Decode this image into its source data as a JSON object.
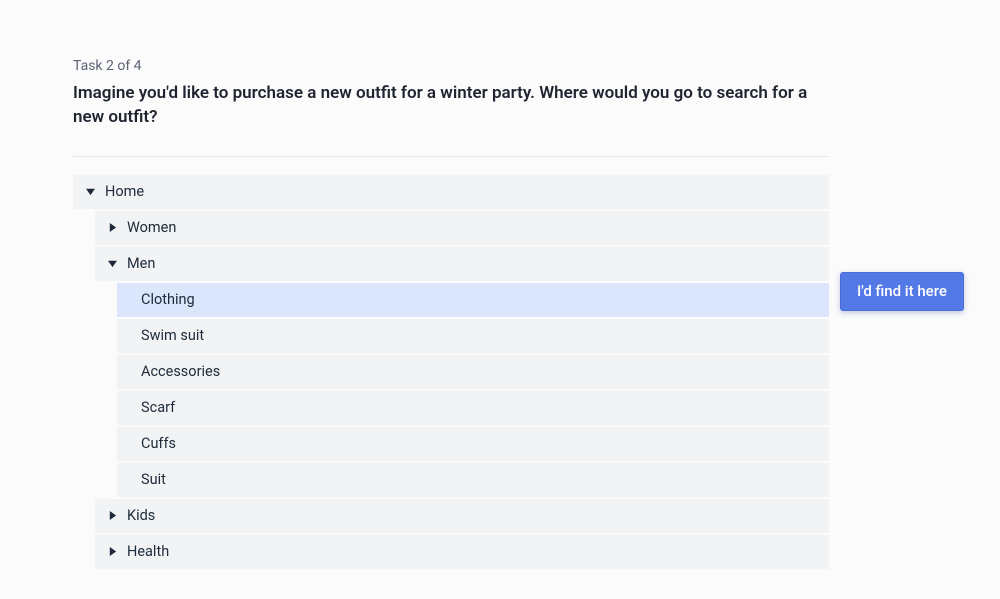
{
  "task": {
    "counter": "Task 2 of 4",
    "prompt": "Imagine you'd like to purchase a new outfit for a winter party. Where would you go to search for a new outfit?"
  },
  "callout": {
    "label": "I'd find it here"
  },
  "tree": {
    "home": "Home",
    "women": "Women",
    "men": "Men",
    "clothing": "Clothing",
    "swimsuit": "Swim suit",
    "accessories": "Accessories",
    "scarf": "Scarf",
    "cuffs": "Cuffs",
    "suit": "Suit",
    "kids": "Kids",
    "health": "Health"
  }
}
